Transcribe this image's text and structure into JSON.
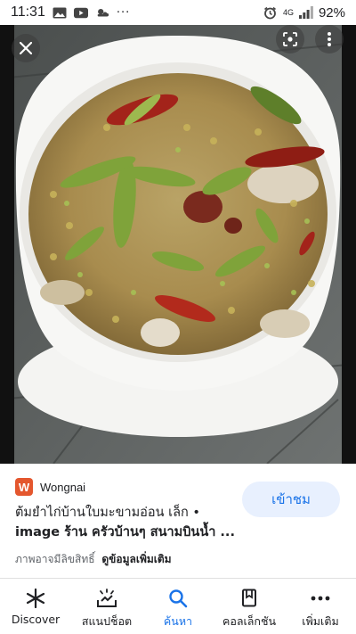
{
  "status_bar": {
    "time": "11:31",
    "more_dots": "···",
    "network": "4G",
    "battery": "92%"
  },
  "image": {
    "alt": "ต้มยำไก่บ้านใบมะขามอ่อน"
  },
  "result": {
    "source_logo_letter": "W",
    "source_name": "Wongnai",
    "title_line1": "ต้มยำไก่บ้านใบมะขามอ่อน เล็ก •",
    "title_line2_bold": "image",
    "title_line2_rest": " ร้าน ครัวบ้านๆ สนามบินน้ำ ...",
    "copyright_text": "ภาพอาจมีลิขสิทธิ์",
    "more_info_link": "ดูข้อมูลเพิ่มเติม",
    "visit_button": "เข้าชม"
  },
  "bottom_nav": [
    {
      "label": "Discover",
      "icon": "asterisk-icon"
    },
    {
      "label": "สแนปช็อต",
      "icon": "snapshot-icon"
    },
    {
      "label": "ค้นหา",
      "icon": "search-icon",
      "active": true
    },
    {
      "label": "คอลเล็กชัน",
      "icon": "collections-icon"
    },
    {
      "label": "เพิ่มเติม",
      "icon": "more-horiz-icon"
    }
  ],
  "colors": {
    "accent": "#1a73e8",
    "visit_bg": "#e8f0fe",
    "wongnai_brand": "#e4572e"
  }
}
